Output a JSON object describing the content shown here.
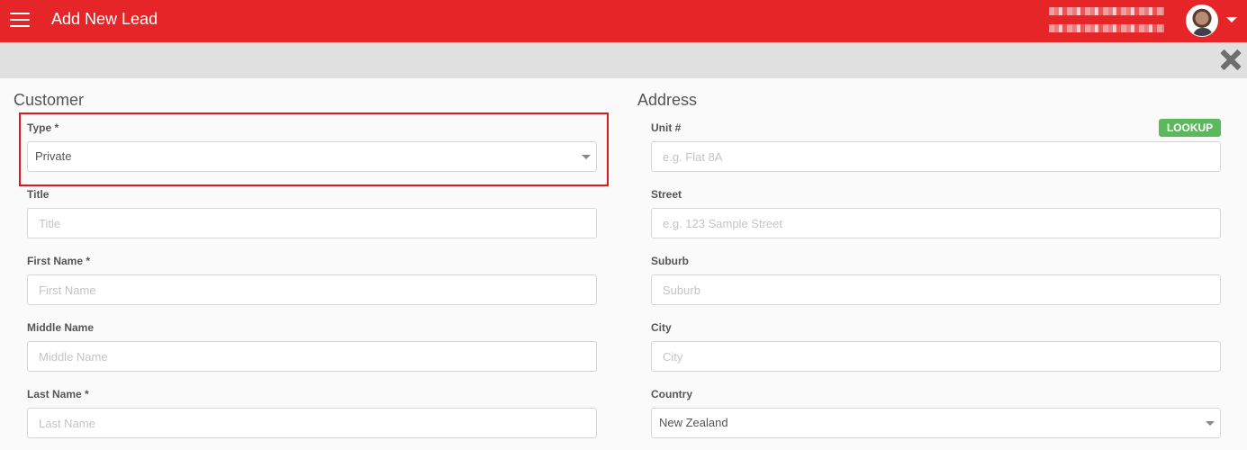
{
  "header": {
    "title": "Add New Lead",
    "menu_icon": "hamburger-icon",
    "user_menu_icon": "caret-down-icon",
    "brand_color": "#e62528"
  },
  "toolbar": {
    "close_icon": "close-icon"
  },
  "customer": {
    "section_title": "Customer",
    "type": {
      "label": "Type *",
      "value": "Private"
    },
    "title": {
      "label": "Title",
      "placeholder": "Title"
    },
    "first_name": {
      "label": "First Name *",
      "placeholder": "First Name"
    },
    "middle_name": {
      "label": "Middle Name",
      "placeholder": "Middle Name"
    },
    "last_name": {
      "label": "Last Name *",
      "placeholder": "Last Name"
    }
  },
  "address": {
    "section_title": "Address",
    "lookup_label": "LOOKUP",
    "unit": {
      "label": "Unit #",
      "placeholder": "e.g. Flat 8A"
    },
    "street": {
      "label": "Street",
      "placeholder": "e.g. 123 Sample Street"
    },
    "suburb": {
      "label": "Suburb",
      "placeholder": "Suburb"
    },
    "city": {
      "label": "City",
      "placeholder": "City"
    },
    "country": {
      "label": "Country",
      "value": "New Zealand"
    }
  }
}
